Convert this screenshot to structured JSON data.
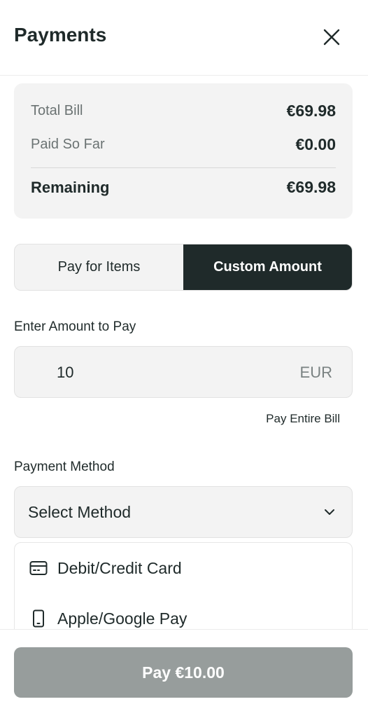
{
  "header": {
    "title": "Payments",
    "close_icon": "close-icon"
  },
  "summary": {
    "total_label": "Total Bill",
    "total_value": "€69.98",
    "paid_label": "Paid So Far",
    "paid_value": "€0.00",
    "remaining_label": "Remaining",
    "remaining_value": "€69.98"
  },
  "tabs": [
    {
      "label": "Pay for Items",
      "active": false
    },
    {
      "label": "Custom Amount",
      "active": true
    }
  ],
  "amount": {
    "label": "Enter Amount to Pay",
    "value": "10",
    "currency": "EUR",
    "pay_entire_label": "Pay Entire Bill"
  },
  "method": {
    "label": "Payment Method",
    "selected": "Select Method",
    "options": [
      {
        "label": "Debit/Credit Card",
        "icon": "credit-card-icon"
      },
      {
        "label": "Apple/Google Pay",
        "icon": "phone-icon"
      }
    ]
  },
  "footer": {
    "pay_button_label": "Pay €10.00"
  },
  "colors": {
    "dark": "#1f2a2a",
    "panel": "#f3f3f3",
    "disabled_button": "#979d9c"
  }
}
